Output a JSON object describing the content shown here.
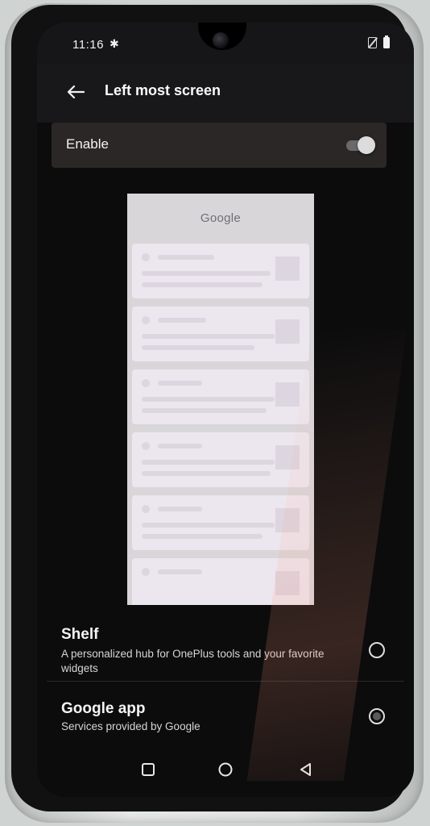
{
  "status_bar": {
    "time": "11:16",
    "left_icon": "satellite-icon",
    "right_icons": [
      "no-sim-icon",
      "battery-icon"
    ]
  },
  "app_bar": {
    "back_icon": "back-arrow-icon",
    "title": "Left most screen"
  },
  "enable": {
    "label": "Enable",
    "toggle_on": true
  },
  "preview": {
    "header": "Google",
    "card_count": 6
  },
  "options": [
    {
      "title": "Shelf",
      "description": "A personalized hub for OnePlus tools and your favorite widgets",
      "selected": false
    },
    {
      "title": "Google app",
      "description": "Services provided by Google",
      "selected": true
    }
  ],
  "nav_bar": {
    "buttons": [
      "recents-icon",
      "home-icon",
      "back-triangle-icon"
    ]
  },
  "colors": {
    "background": "#0c0c0d",
    "enable_row": "#2a2726",
    "text": "#f4f4f4",
    "preview_bg": "#d9d6da",
    "preview_card": "#ece6ee"
  }
}
